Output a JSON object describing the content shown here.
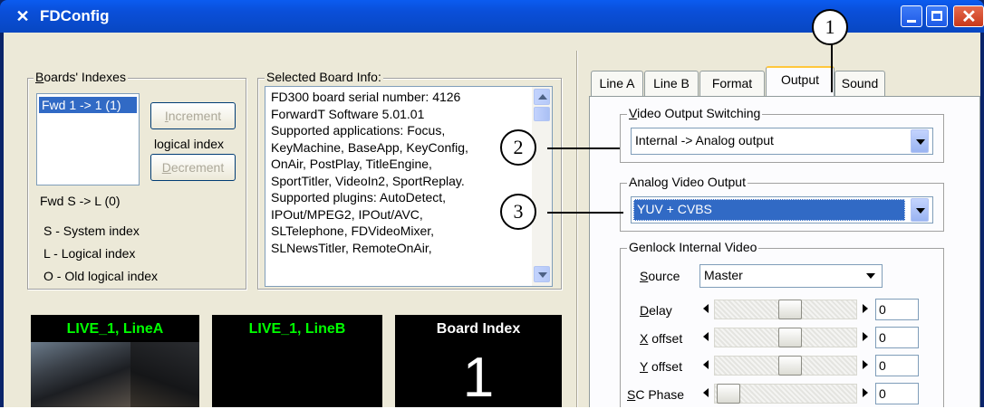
{
  "window": {
    "title": "FDConfig",
    "app_icon": "tools-icon"
  },
  "boards_indexes": {
    "legend_pre": "",
    "legend_u": "B",
    "legend_post": "oards' Indexes",
    "list_items": [
      "Fwd 1 -> 1 (1)"
    ],
    "increment_u": "I",
    "increment_rest": "ncrement",
    "logical_index_label": "logical index",
    "decrement_u": "D",
    "decrement_rest": "ecrement",
    "fwd_sl": "Fwd S -> L (0)",
    "legend_lines": [
      "S - System index",
      "L - Logical index",
      "O - Old logical index"
    ]
  },
  "board_info": {
    "legend": "Selected Board Info:",
    "lines": [
      "FD300 board serial number: 4126",
      "ForwardT Software 5.01.01",
      "Supported applications: Focus,",
      "KeyMachine, BaseApp, KeyConfig,",
      "OnAir, PostPlay, TitleEngine,",
      "SportTitler, VideoIn2, SportReplay.",
      "Supported plugins: AutoDetect,",
      "IPOut/MPEG2, IPOut/AVC,",
      "SLTelephone, FDVideoMixer,",
      "SLNewsTitler, RemoteOnAir,"
    ]
  },
  "previews": {
    "a": "LIVE_1, LineA",
    "b": "LIVE_1, LineB",
    "index_title": "Board Index",
    "index_value": "1"
  },
  "tabs": [
    "Line A",
    "Line B",
    "Format",
    "Output",
    "Sound"
  ],
  "active_tab": "Output",
  "output": {
    "video_switching_u": "V",
    "video_switching_rest": "ideo Output Switching",
    "video_switching_value": "Internal -> Analog output",
    "analog_legend": "Analog Video Output",
    "analog_value": "YUV + CVBS",
    "genlock_legend": "Genlock Internal Video",
    "source_u": "S",
    "source_rest": "ource",
    "source_value": "Master",
    "rows": [
      {
        "u": "D",
        "rest": "elay",
        "pre": "",
        "value": "0",
        "level": 0.55
      },
      {
        "u": "X",
        "rest": " offset",
        "pre": "",
        "value": "0",
        "level": 0.55
      },
      {
        "u": "Y",
        "rest": " offset",
        "pre": "",
        "value": "0",
        "level": 0.55
      },
      {
        "u": "S",
        "rest": "C Phase",
        "pre": "",
        "value": "0",
        "level": 0.0
      }
    ]
  },
  "callouts": [
    "1",
    "2",
    "3"
  ],
  "colors": {
    "live_label": "#00ff00",
    "selection": "#316ac5",
    "tab_accent": "#ffc73c"
  }
}
